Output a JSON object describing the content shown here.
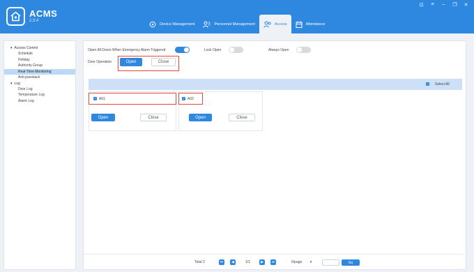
{
  "app": {
    "title": "ACMS",
    "version": "2.3.4"
  },
  "window": {
    "pin": "⊡",
    "menu": "≡",
    "minimize": "–",
    "restore": "❐",
    "close": "✕"
  },
  "nav": {
    "tabs": [
      {
        "label": "Device Management",
        "icon": "device-icon"
      },
      {
        "label": "Personnel Management",
        "icon": "people-icon"
      },
      {
        "label": "Access",
        "icon": "access-icon",
        "active": true
      },
      {
        "label": "Attendance",
        "icon": "calendar-icon"
      }
    ]
  },
  "sidebar": {
    "group1": {
      "label": "Access Control",
      "arrow": "▾"
    },
    "items1": [
      "Schedule",
      "Holiday",
      "Authority Group",
      "Real-Time Monitoring",
      "Anti-passback"
    ],
    "group2": {
      "label": "Log",
      "arrow": "▾"
    },
    "items2": [
      "Door Log",
      "Temperature Log",
      "Alarm Log"
    ]
  },
  "main": {
    "emergency_label": "Open All Doors When Emergency Alarm Triggered",
    "emergency_on": true,
    "lock_label": "Lock Open",
    "lock_on": false,
    "always_label": "Always Open",
    "always_on": false,
    "door_op_label": "Door Operation",
    "open_label": "Open",
    "close_label": "Close",
    "select_all": "Select All",
    "devices": [
      {
        "name": "A01",
        "checked": true,
        "open": "Open",
        "close": "Close"
      },
      {
        "name": "A02",
        "checked": true,
        "open": "Open",
        "close": "Close"
      }
    ]
  },
  "pager": {
    "total": "Total 2",
    "first": "⏮",
    "prev": "◀",
    "page": "1/1",
    "next": "▶",
    "last": "⏭",
    "per_page": "6/page",
    "per_page_arrow": "▾",
    "go": "Go"
  },
  "colors": {
    "accent": "#2f88e0",
    "highlight": "#e8483b",
    "select_bar": "#cde0f7"
  }
}
